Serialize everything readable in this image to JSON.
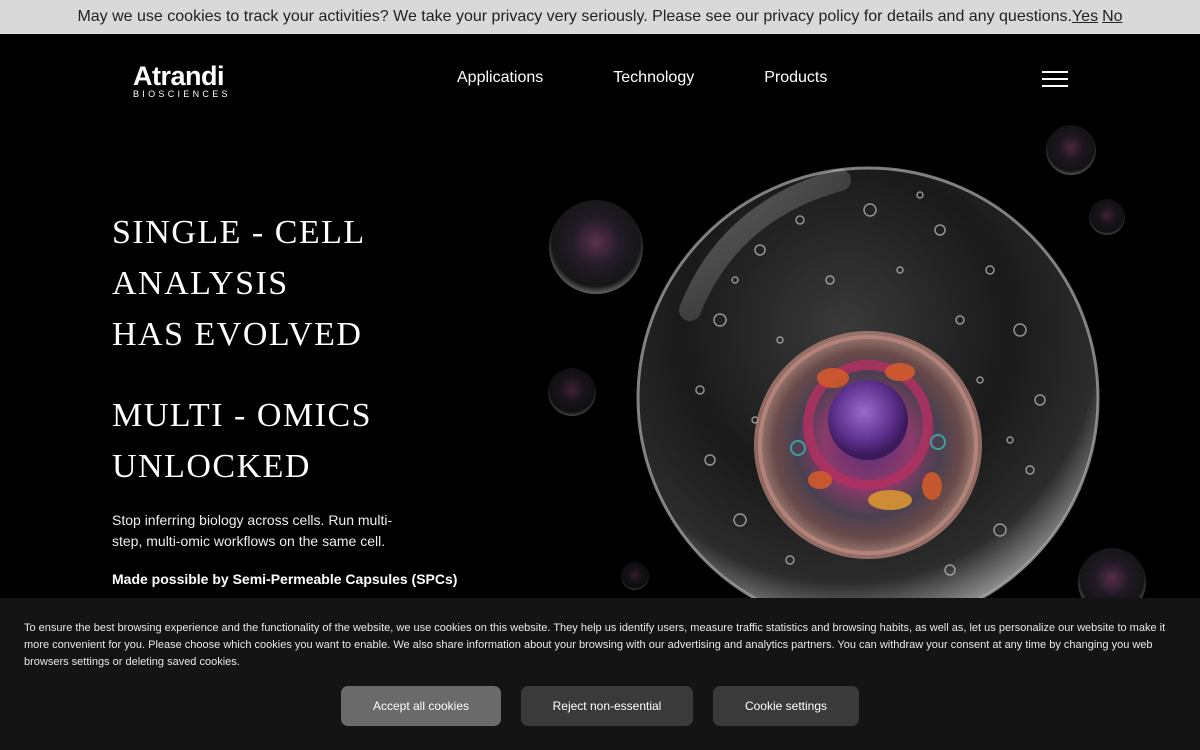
{
  "top_notice": {
    "text": "May we use cookies to track your activities? We take your privacy very seriously. Please see our privacy policy for details and any questions.",
    "yes": "Yes",
    "no": "No"
  },
  "header": {
    "logo_word": "Atrandi",
    "logo_sub": "BIOSCIENCES",
    "nav": [
      "Applications",
      "Technology",
      "Products"
    ],
    "menu_icon": "hamburger-icon"
  },
  "hero": {
    "title_lines": [
      "SINGLE - CELL",
      "ANALYSIS",
      "HAS EVOLVED"
    ],
    "title2_lines": [
      "MULTI - OMICS",
      "UNLOCKED"
    ],
    "description": "Stop inferring biology across cells. Run multi-step, multi-omic workflows on the same cell.",
    "note": "Made possible by Semi-Permeable Capsules (SPCs)"
  },
  "cookie_banner": {
    "text": "To ensure the best browsing experience and the functionality of the website, we use cookies on this website. They help us identify users, measure traffic statistics and browsing habits, as well as, let us personalize our website to make it more convenient for you. Please choose which cookies you want to enable. We also share information about your browsing with our advertising and analytics partners. You can withdraw your consent at any time by changing you web browsers settings or deleting saved cookies.",
    "accept": "Accept all cookies",
    "reject": "Reject non-essential",
    "settings": "Cookie settings"
  },
  "colors": {
    "background": "#000000",
    "top_notice_bg": "#d9d9d9",
    "banner_bg": "#141414",
    "accept_btn": "#6a6a6a",
    "secondary_btn": "#3a3a3a"
  }
}
